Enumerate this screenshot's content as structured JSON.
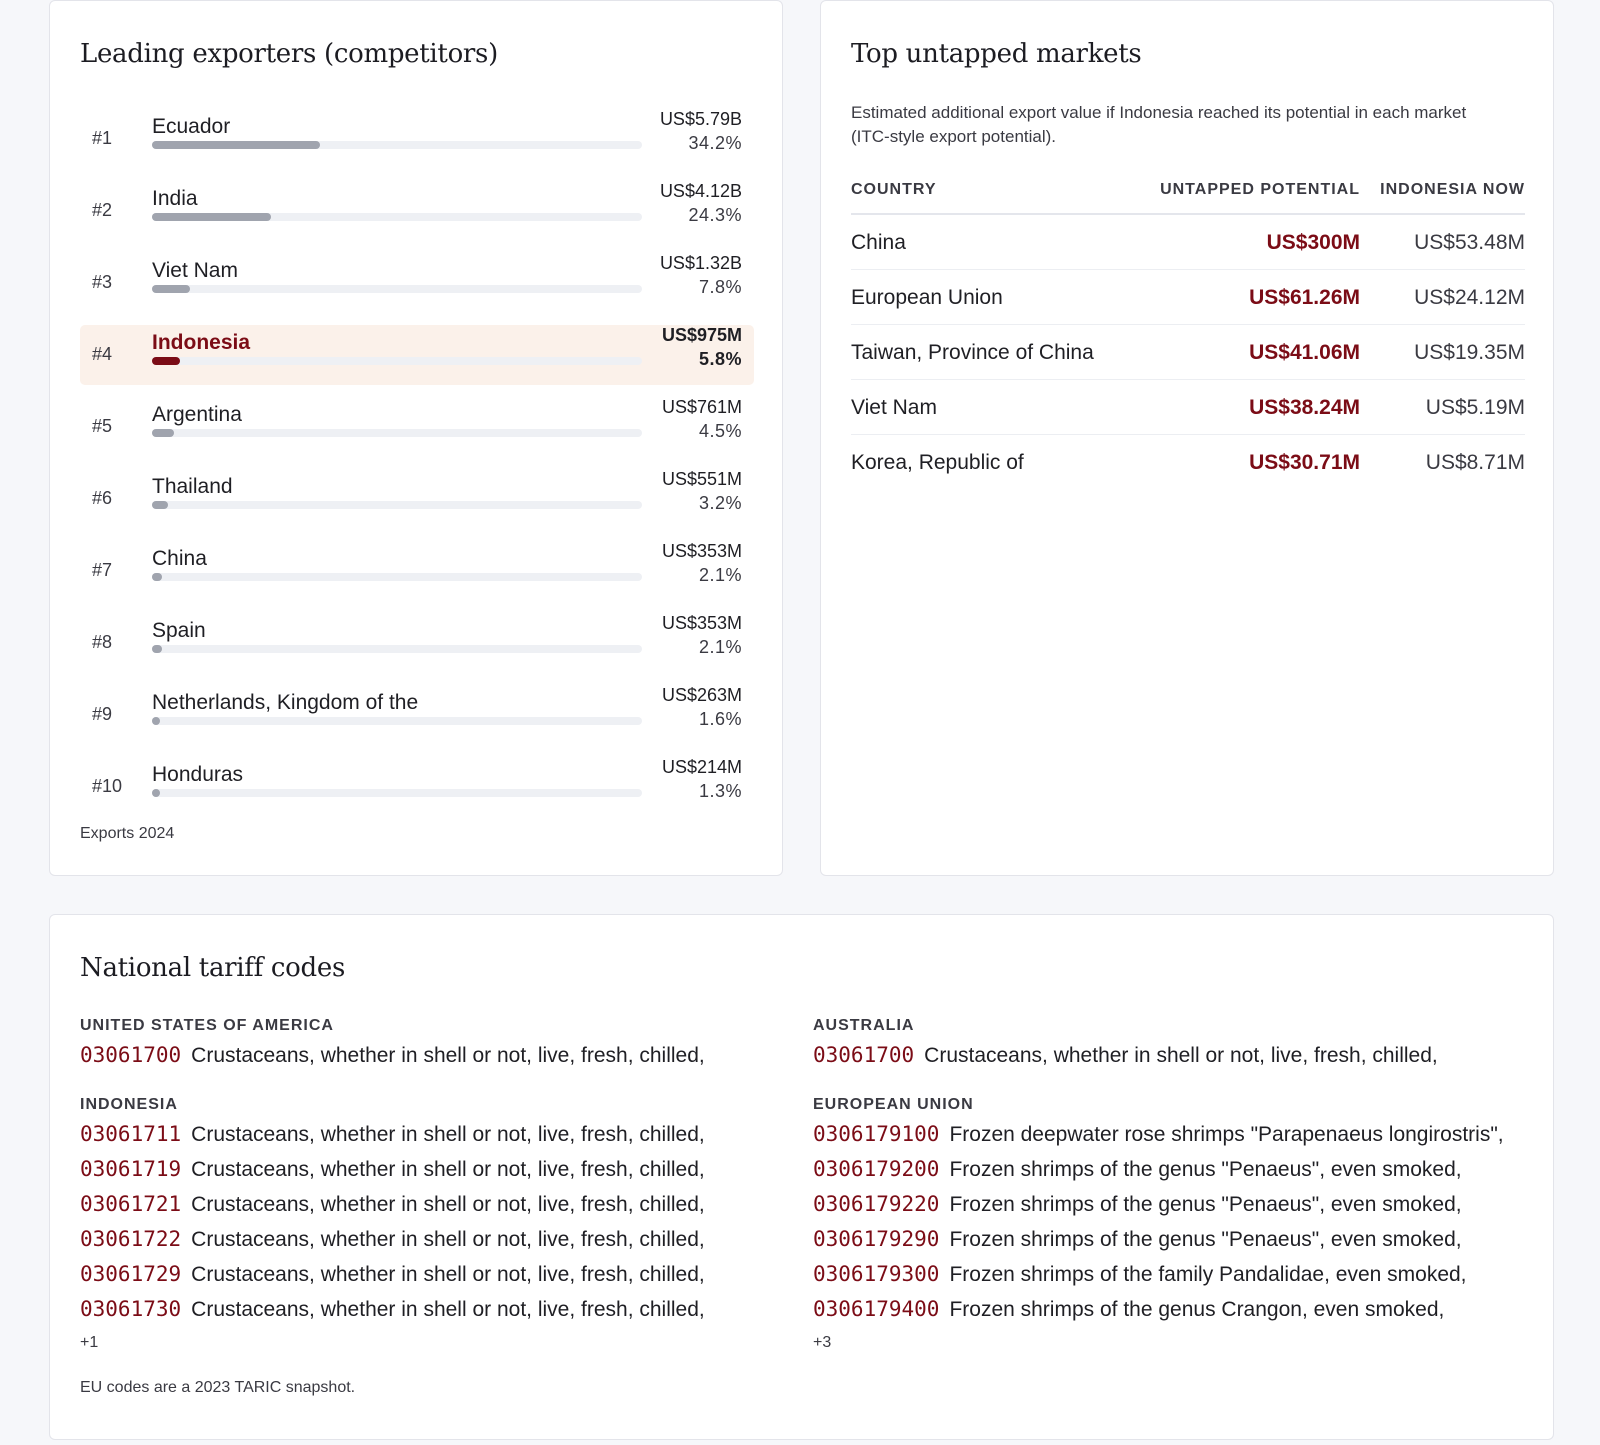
{
  "exporters": {
    "title": "Leading exporters (competitors)",
    "footnote": "Exports 2024",
    "items": [
      {
        "rank": "#1",
        "name": "Ecuador",
        "value": "US$5.79B",
        "share": "34.2%",
        "share_pct": 34.2,
        "highlight": false
      },
      {
        "rank": "#2",
        "name": "India",
        "value": "US$4.12B",
        "share": "24.3%",
        "share_pct": 24.3,
        "highlight": false
      },
      {
        "rank": "#3",
        "name": "Viet Nam",
        "value": "US$1.32B",
        "share": "7.8%",
        "share_pct": 7.8,
        "highlight": false
      },
      {
        "rank": "#4",
        "name": "Indonesia",
        "value": "US$975M",
        "share": "5.8%",
        "share_pct": 5.8,
        "highlight": true
      },
      {
        "rank": "#5",
        "name": "Argentina",
        "value": "US$761M",
        "share": "4.5%",
        "share_pct": 4.5,
        "highlight": false
      },
      {
        "rank": "#6",
        "name": "Thailand",
        "value": "US$551M",
        "share": "3.2%",
        "share_pct": 3.2,
        "highlight": false
      },
      {
        "rank": "#7",
        "name": "China",
        "value": "US$353M",
        "share": "2.1%",
        "share_pct": 2.1,
        "highlight": false
      },
      {
        "rank": "#8",
        "name": "Spain",
        "value": "US$353M",
        "share": "2.1%",
        "share_pct": 2.1,
        "highlight": false
      },
      {
        "rank": "#9",
        "name": "Netherlands, Kingdom of the",
        "value": "US$263M",
        "share": "1.6%",
        "share_pct": 1.6,
        "highlight": false
      },
      {
        "rank": "#10",
        "name": "Honduras",
        "value": "US$214M",
        "share": "1.3%",
        "share_pct": 1.3,
        "highlight": false
      }
    ]
  },
  "untapped": {
    "title": "Top untapped markets",
    "description": "Estimated additional export value if Indonesia reached its potential in each market (ITC-style export potential).",
    "columns": {
      "country": "Country",
      "potential": "Untapped potential",
      "now": "Indonesia now"
    },
    "rows": [
      {
        "country": "China",
        "potential": "US$300M",
        "now": "US$53.48M"
      },
      {
        "country": "European Union",
        "potential": "US$61.26M",
        "now": "US$24.12M"
      },
      {
        "country": "Taiwan, Province of China",
        "potential": "US$41.06M",
        "now": "US$19.35M"
      },
      {
        "country": "Viet Nam",
        "potential": "US$38.24M",
        "now": "US$5.19M"
      },
      {
        "country": "Korea, Republic of",
        "potential": "US$30.71M",
        "now": "US$8.71M"
      }
    ]
  },
  "tariff": {
    "title": "National tariff codes",
    "footnote": "EU codes are a 2023 TARIC snapshot.",
    "left": [
      {
        "country": "United States of America",
        "more": "",
        "lines": [
          {
            "code": "03061700",
            "desc": "Crustaceans, whether in shell or not, live, fresh, chilled,"
          }
        ]
      },
      {
        "country": "Indonesia",
        "more": "+1",
        "lines": [
          {
            "code": "03061711",
            "desc": "Crustaceans, whether in shell or not, live, fresh, chilled,"
          },
          {
            "code": "03061719",
            "desc": "Crustaceans, whether in shell or not, live, fresh, chilled,"
          },
          {
            "code": "03061721",
            "desc": "Crustaceans, whether in shell or not, live, fresh, chilled,"
          },
          {
            "code": "03061722",
            "desc": "Crustaceans, whether in shell or not, live, fresh, chilled,"
          },
          {
            "code": "03061729",
            "desc": "Crustaceans, whether in shell or not, live, fresh, chilled,"
          },
          {
            "code": "03061730",
            "desc": "Crustaceans, whether in shell or not, live, fresh, chilled,"
          }
        ]
      }
    ],
    "right": [
      {
        "country": "Australia",
        "more": "",
        "lines": [
          {
            "code": "03061700",
            "desc": "Crustaceans, whether in shell or not, live, fresh, chilled,"
          }
        ]
      },
      {
        "country": "European Union",
        "more": "+3",
        "lines": [
          {
            "code": "0306179100",
            "desc": "Frozen deepwater rose shrimps \"Parapenaeus longirostris\","
          },
          {
            "code": "0306179200",
            "desc": "Frozen shrimps of the genus \"Penaeus\", even smoked,"
          },
          {
            "code": "0306179220",
            "desc": "Frozen shrimps of the genus \"Penaeus\", even smoked,"
          },
          {
            "code": "0306179290",
            "desc": "Frozen shrimps of the genus \"Penaeus\", even smoked,"
          },
          {
            "code": "0306179300",
            "desc": "Frozen shrimps of the family Pandalidae, even smoked,"
          },
          {
            "code": "0306179400",
            "desc": "Frozen shrimps of the genus Crangon, even smoked,"
          }
        ]
      }
    ]
  },
  "colors": {
    "accent": "#7b0c16",
    "bar": "#a0a4ae",
    "highlight_bg": "#fbf1ea"
  }
}
